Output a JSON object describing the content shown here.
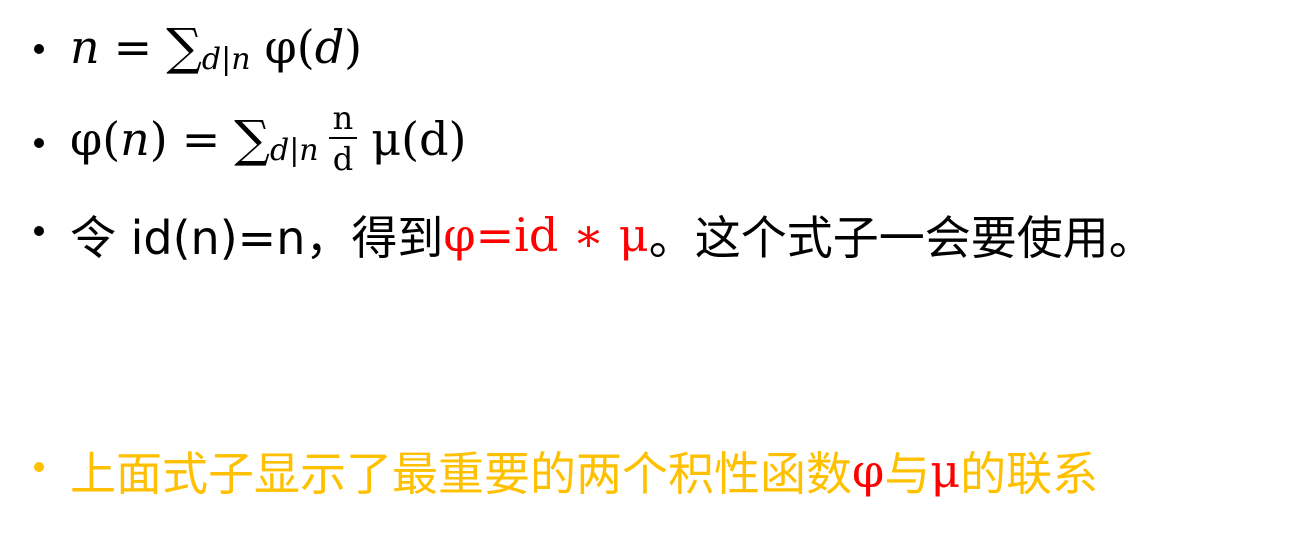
{
  "lines": [
    {
      "parts": {
        "n": "n",
        "eq": "=",
        "sum": "∑",
        "sub": "d|n",
        "phi": "φ(",
        "d": "d",
        "close": ")"
      }
    },
    {
      "parts": {
        "phi": "φ(",
        "n": "n",
        "close": ")",
        "eq": "=",
        "sum": "∑",
        "sub": "d|n",
        "frac_num": "n",
        "frac_den": "d",
        "mu": "μ(d)"
      }
    },
    {
      "prefix": "令 id(n)=n，得到 ",
      "formula": "φ=id ∗ μ",
      "suffix": "。这个式子一会要使用。"
    },
    {
      "text_a": "上面式子显示了最重要的两个积性函数",
      "phi": "φ",
      "text_b": "与",
      "mu": "μ",
      "text_c": "的联系"
    }
  ],
  "colors": {
    "text": "#000000",
    "highlight_red": "#ff0000",
    "highlight_gold": "#ffc000"
  }
}
